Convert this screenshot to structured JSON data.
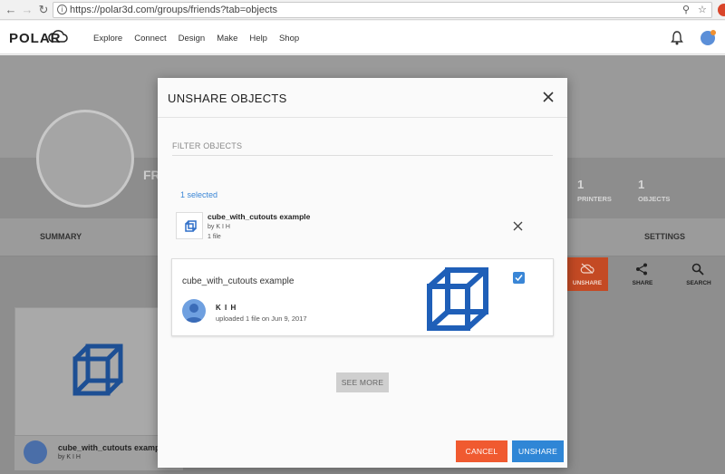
{
  "browser": {
    "url": "https://polar3d.com/groups/friends?tab=objects",
    "back_icon": "arrow-left-icon",
    "forward_icon": "arrow-right-icon",
    "reload_icon": "reload-icon"
  },
  "header": {
    "logo": "POLAR",
    "nav": [
      "Explore",
      "Connect",
      "Design",
      "Make",
      "Help",
      "Shop"
    ]
  },
  "background": {
    "profile_name_partial": "FR",
    "stats": [
      {
        "num": "1",
        "label": "PRINTERS"
      },
      {
        "num": "1",
        "label": "OBJECTS"
      }
    ],
    "tabs": {
      "summary": "SUMMARY",
      "settings": "SETTINGS"
    },
    "actions": {
      "unshare": "UNSHARE",
      "share": "SHARE",
      "search": "SEARCH"
    },
    "card": {
      "title": "cube_with_cutouts exampl",
      "by": "by K I H"
    }
  },
  "modal": {
    "title": "UNSHARE OBJECTS",
    "filter_placeholder": "FILTER OBJECTS",
    "selected_count": "1 selected",
    "selected_item": {
      "title": "cube_with_cutouts example",
      "by": "by K I H",
      "files": "1 file"
    },
    "object": {
      "title": "cube_with_cutouts example",
      "author": "K I H",
      "meta": "uploaded 1 file on Jun 9, 2017",
      "checked": true
    },
    "see_more": "SEE MORE",
    "cancel": "CANCEL",
    "unshare": "UNSHARE"
  },
  "colors": {
    "accent_blue": "#2f86d6",
    "cancel_orange": "#f05a30",
    "cube_blue": "#1f5fb8"
  }
}
